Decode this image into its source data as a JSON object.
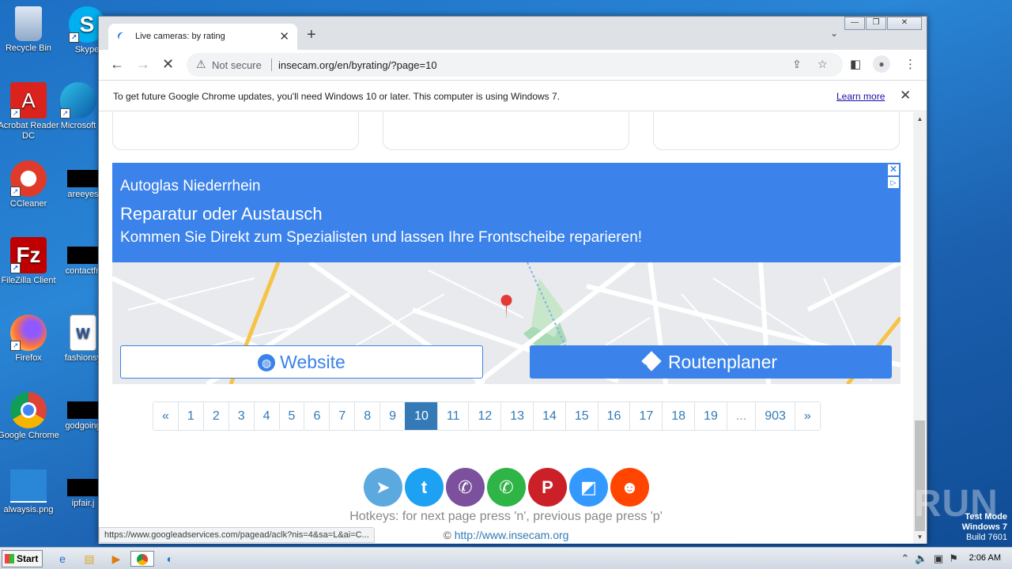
{
  "desktop": {
    "icons": [
      {
        "label": "Recycle Bin"
      },
      {
        "label": "Skype"
      },
      {
        "label": "Acrobat Reader DC"
      },
      {
        "label": "Microsoft"
      },
      {
        "label": "CCleaner"
      },
      {
        "label": "areeyes"
      },
      {
        "label": "FileZilla Client"
      },
      {
        "label": "contactfri"
      },
      {
        "label": "Firefox"
      },
      {
        "label": "fashionsy"
      },
      {
        "label": "Google Chrome"
      },
      {
        "label": "godgoing"
      },
      {
        "label": "alwaysis.png"
      },
      {
        "label": "ipfair.j"
      }
    ]
  },
  "browser": {
    "tab": {
      "title": "Live cameras: by rating",
      "close_glyph": "✕"
    },
    "new_tab_glyph": "+",
    "address": {
      "security": "Not secure",
      "url": "insecam.org/en/byrating/?page=10"
    },
    "infobar": {
      "message": "To get future Google Chrome updates, you'll need Windows 10 or later. This computer is using Windows 7.",
      "link": "Learn more",
      "close_glyph": "✕"
    },
    "status_url": "https://www.googleadservices.com/pagead/aclk?nis=4&sa=L&ai=C..."
  },
  "page": {
    "ad": {
      "line1": "Autoglas Niederrhein",
      "line2": "Reparatur oder Austausch",
      "line3": "Kommen Sie Direkt zum Spezialisten und lassen Ihre Frontscheibe reparieren!",
      "website_button": "Website",
      "route_button": "Routenplaner",
      "close_glyph": "✕",
      "info_glyph": "▷"
    },
    "pagination": {
      "prev": "«",
      "pages": [
        "1",
        "2",
        "3",
        "4",
        "5",
        "6",
        "7",
        "8",
        "9",
        "10",
        "11",
        "12",
        "13",
        "14",
        "15",
        "16",
        "17",
        "18",
        "19",
        "...",
        "903"
      ],
      "current": "10",
      "next": "»"
    },
    "share": [
      {
        "name": "telegram",
        "color": "#5ca9e0",
        "glyph": "➤"
      },
      {
        "name": "twitter",
        "color": "#1da1f2",
        "glyph": "t"
      },
      {
        "name": "viber",
        "color": "#7b519d",
        "glyph": "✆"
      },
      {
        "name": "whatsapp",
        "color": "#2fb446",
        "glyph": "✆"
      },
      {
        "name": "pinterest",
        "color": "#cb2027",
        "glyph": "P"
      },
      {
        "name": "delicious",
        "color": "#3399ff",
        "glyph": "◩"
      },
      {
        "name": "reddit",
        "color": "#ff4500",
        "glyph": "☻"
      }
    ],
    "hotkeys": "Hotkeys: for next page press 'n', previous page press 'p'",
    "copyright_symbol": "©",
    "copyright_link": "http://www.insecam.org"
  },
  "watermark": {
    "brand": "ANY RUN",
    "line1": "Test Mode",
    "line2": "Windows 7",
    "line3": "Build 7601"
  },
  "taskbar": {
    "start_label": "Start",
    "clock": "2:06 AM"
  }
}
